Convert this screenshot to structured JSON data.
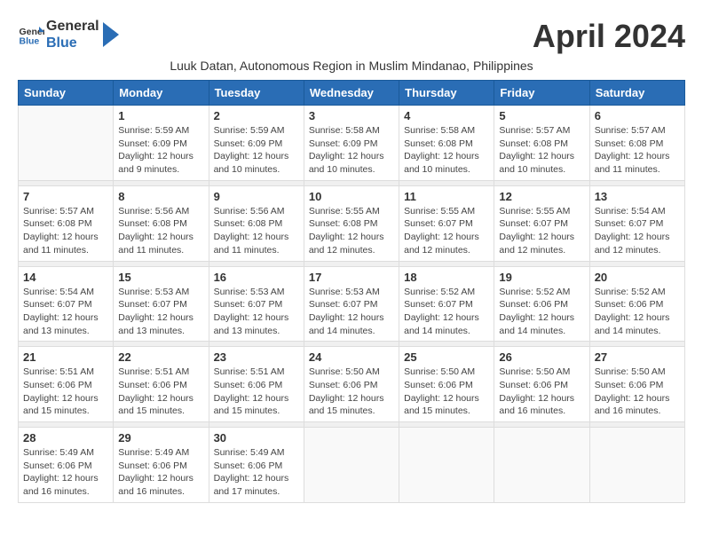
{
  "header": {
    "logo_line1": "General",
    "logo_line2": "Blue",
    "month_title": "April 2024",
    "subtitle": "Luuk Datan, Autonomous Region in Muslim Mindanao, Philippines"
  },
  "weekdays": [
    "Sunday",
    "Monday",
    "Tuesday",
    "Wednesday",
    "Thursday",
    "Friday",
    "Saturday"
  ],
  "weeks": [
    [
      {
        "day": "",
        "info": ""
      },
      {
        "day": "1",
        "info": "Sunrise: 5:59 AM\nSunset: 6:09 PM\nDaylight: 12 hours\nand 9 minutes."
      },
      {
        "day": "2",
        "info": "Sunrise: 5:59 AM\nSunset: 6:09 PM\nDaylight: 12 hours\nand 10 minutes."
      },
      {
        "day": "3",
        "info": "Sunrise: 5:58 AM\nSunset: 6:09 PM\nDaylight: 12 hours\nand 10 minutes."
      },
      {
        "day": "4",
        "info": "Sunrise: 5:58 AM\nSunset: 6:08 PM\nDaylight: 12 hours\nand 10 minutes."
      },
      {
        "day": "5",
        "info": "Sunrise: 5:57 AM\nSunset: 6:08 PM\nDaylight: 12 hours\nand 10 minutes."
      },
      {
        "day": "6",
        "info": "Sunrise: 5:57 AM\nSunset: 6:08 PM\nDaylight: 12 hours\nand 11 minutes."
      }
    ],
    [
      {
        "day": "7",
        "info": "Sunrise: 5:57 AM\nSunset: 6:08 PM\nDaylight: 12 hours\nand 11 minutes."
      },
      {
        "day": "8",
        "info": "Sunrise: 5:56 AM\nSunset: 6:08 PM\nDaylight: 12 hours\nand 11 minutes."
      },
      {
        "day": "9",
        "info": "Sunrise: 5:56 AM\nSunset: 6:08 PM\nDaylight: 12 hours\nand 11 minutes."
      },
      {
        "day": "10",
        "info": "Sunrise: 5:55 AM\nSunset: 6:08 PM\nDaylight: 12 hours\nand 12 minutes."
      },
      {
        "day": "11",
        "info": "Sunrise: 5:55 AM\nSunset: 6:07 PM\nDaylight: 12 hours\nand 12 minutes."
      },
      {
        "day": "12",
        "info": "Sunrise: 5:55 AM\nSunset: 6:07 PM\nDaylight: 12 hours\nand 12 minutes."
      },
      {
        "day": "13",
        "info": "Sunrise: 5:54 AM\nSunset: 6:07 PM\nDaylight: 12 hours\nand 12 minutes."
      }
    ],
    [
      {
        "day": "14",
        "info": "Sunrise: 5:54 AM\nSunset: 6:07 PM\nDaylight: 12 hours\nand 13 minutes."
      },
      {
        "day": "15",
        "info": "Sunrise: 5:53 AM\nSunset: 6:07 PM\nDaylight: 12 hours\nand 13 minutes."
      },
      {
        "day": "16",
        "info": "Sunrise: 5:53 AM\nSunset: 6:07 PM\nDaylight: 12 hours\nand 13 minutes."
      },
      {
        "day": "17",
        "info": "Sunrise: 5:53 AM\nSunset: 6:07 PM\nDaylight: 12 hours\nand 14 minutes."
      },
      {
        "day": "18",
        "info": "Sunrise: 5:52 AM\nSunset: 6:07 PM\nDaylight: 12 hours\nand 14 minutes."
      },
      {
        "day": "19",
        "info": "Sunrise: 5:52 AM\nSunset: 6:06 PM\nDaylight: 12 hours\nand 14 minutes."
      },
      {
        "day": "20",
        "info": "Sunrise: 5:52 AM\nSunset: 6:06 PM\nDaylight: 12 hours\nand 14 minutes."
      }
    ],
    [
      {
        "day": "21",
        "info": "Sunrise: 5:51 AM\nSunset: 6:06 PM\nDaylight: 12 hours\nand 15 minutes."
      },
      {
        "day": "22",
        "info": "Sunrise: 5:51 AM\nSunset: 6:06 PM\nDaylight: 12 hours\nand 15 minutes."
      },
      {
        "day": "23",
        "info": "Sunrise: 5:51 AM\nSunset: 6:06 PM\nDaylight: 12 hours\nand 15 minutes."
      },
      {
        "day": "24",
        "info": "Sunrise: 5:50 AM\nSunset: 6:06 PM\nDaylight: 12 hours\nand 15 minutes."
      },
      {
        "day": "25",
        "info": "Sunrise: 5:50 AM\nSunset: 6:06 PM\nDaylight: 12 hours\nand 15 minutes."
      },
      {
        "day": "26",
        "info": "Sunrise: 5:50 AM\nSunset: 6:06 PM\nDaylight: 12 hours\nand 16 minutes."
      },
      {
        "day": "27",
        "info": "Sunrise: 5:50 AM\nSunset: 6:06 PM\nDaylight: 12 hours\nand 16 minutes."
      }
    ],
    [
      {
        "day": "28",
        "info": "Sunrise: 5:49 AM\nSunset: 6:06 PM\nDaylight: 12 hours\nand 16 minutes."
      },
      {
        "day": "29",
        "info": "Sunrise: 5:49 AM\nSunset: 6:06 PM\nDaylight: 12 hours\nand 16 minutes."
      },
      {
        "day": "30",
        "info": "Sunrise: 5:49 AM\nSunset: 6:06 PM\nDaylight: 12 hours\nand 17 minutes."
      },
      {
        "day": "",
        "info": ""
      },
      {
        "day": "",
        "info": ""
      },
      {
        "day": "",
        "info": ""
      },
      {
        "day": "",
        "info": ""
      }
    ]
  ]
}
